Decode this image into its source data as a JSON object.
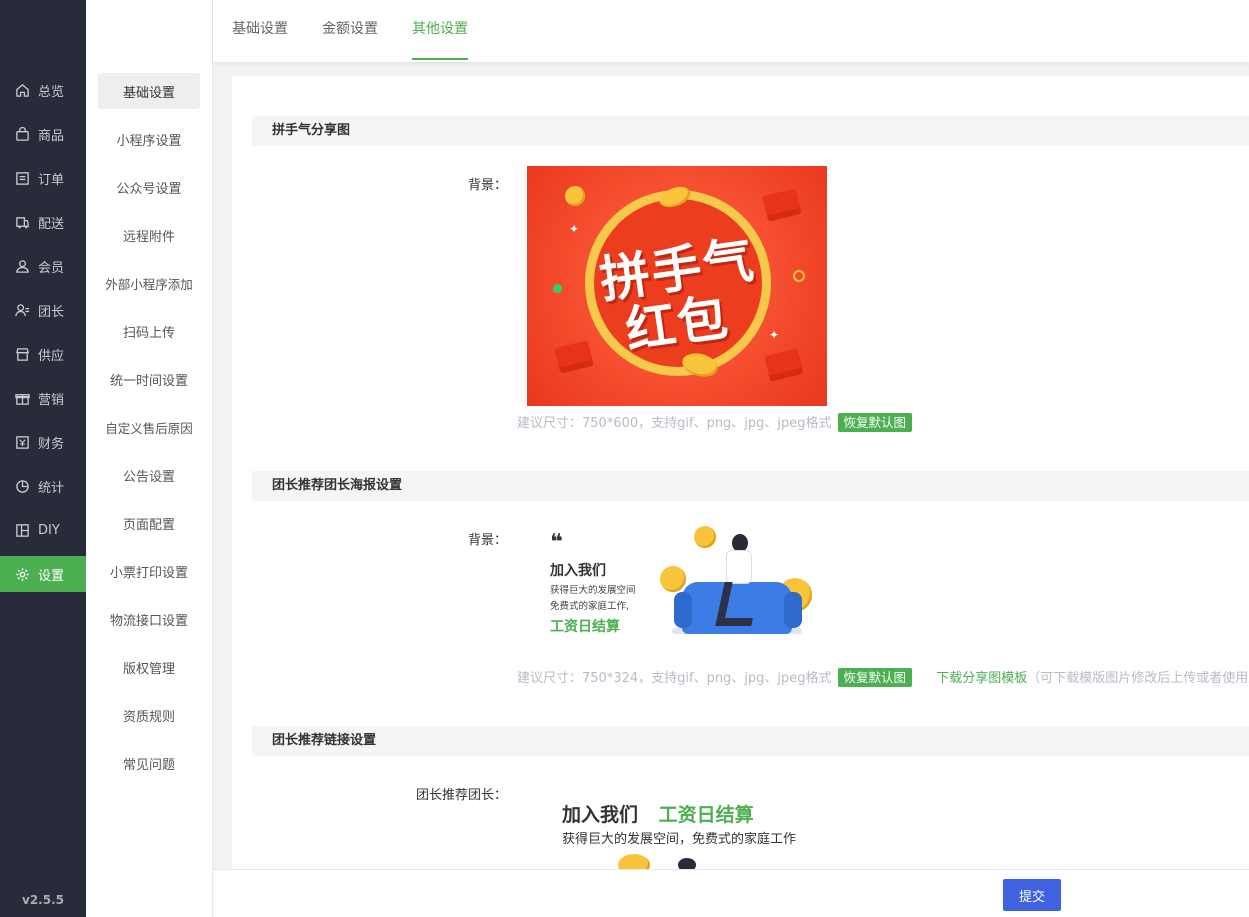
{
  "nav": {
    "items": [
      {
        "label": "总览",
        "icon": "home-icon"
      },
      {
        "label": "商品",
        "icon": "shopping-bag-icon"
      },
      {
        "label": "订单",
        "icon": "order-icon"
      },
      {
        "label": "配送",
        "icon": "delivery-icon"
      },
      {
        "label": "会员",
        "icon": "user-icon"
      },
      {
        "label": "团长",
        "icon": "team-leader-icon"
      },
      {
        "label": "供应",
        "icon": "store-icon"
      },
      {
        "label": "营销",
        "icon": "gift-icon"
      },
      {
        "label": "财务",
        "icon": "finance-icon"
      },
      {
        "label": "统计",
        "icon": "pie-chart-icon"
      },
      {
        "label": "DIY",
        "icon": "layout-icon"
      },
      {
        "label": "设置",
        "icon": "gear-icon"
      }
    ],
    "active": "设置",
    "version": "v2.5.5"
  },
  "submenu": {
    "items": [
      "基础设置",
      "小程序设置",
      "公众号设置",
      "远程附件",
      "外部小程序添加",
      "扫码上传",
      "统一时间设置",
      "自定义售后原因",
      "公告设置",
      "页面配置",
      "小票打印设置",
      "物流接口设置",
      "版权管理",
      "资质规则",
      "常见问题"
    ],
    "active": "基础设置"
  },
  "tabs": {
    "items": [
      "基础设置",
      "金额设置",
      "其他设置"
    ],
    "active": "其他设置"
  },
  "sections": {
    "share": {
      "title": "拼手气分享图",
      "label": "背景：",
      "banner_text_line1": "拼手气",
      "banner_text_line2": "红包",
      "hint": "建议尺寸：750*600，支持gif、png、jpg、jpeg格式",
      "restore": "恢复默认图"
    },
    "poster": {
      "title": "团长推荐团长海报设置",
      "label": "背景：",
      "quote_mark": "❝",
      "poster_title": "加入我们",
      "poster_line1": "获得巨大的发展空间",
      "poster_line2": "免费式的家庭工作,",
      "poster_green": "工资日结算",
      "hint": "建议尺寸：750*324，支持gif、png、jpg、jpeg格式",
      "restore": "恢复默认图",
      "download": "下载分享图模板",
      "download_note": "（可下载模版图片修改后上传或者使用默认"
    },
    "link": {
      "title": "团长推荐链接设置",
      "label": "团长推荐团长：",
      "title_black": "加入我们",
      "title_green": "工资日结算",
      "subtitle": "获得巨大的发展空间，免费式的家庭工作"
    }
  },
  "footer": {
    "submit": "提交"
  },
  "colors": {
    "accent": "#4caf50",
    "nav_bg": "#282b3a",
    "submit": "#3f63e0"
  }
}
